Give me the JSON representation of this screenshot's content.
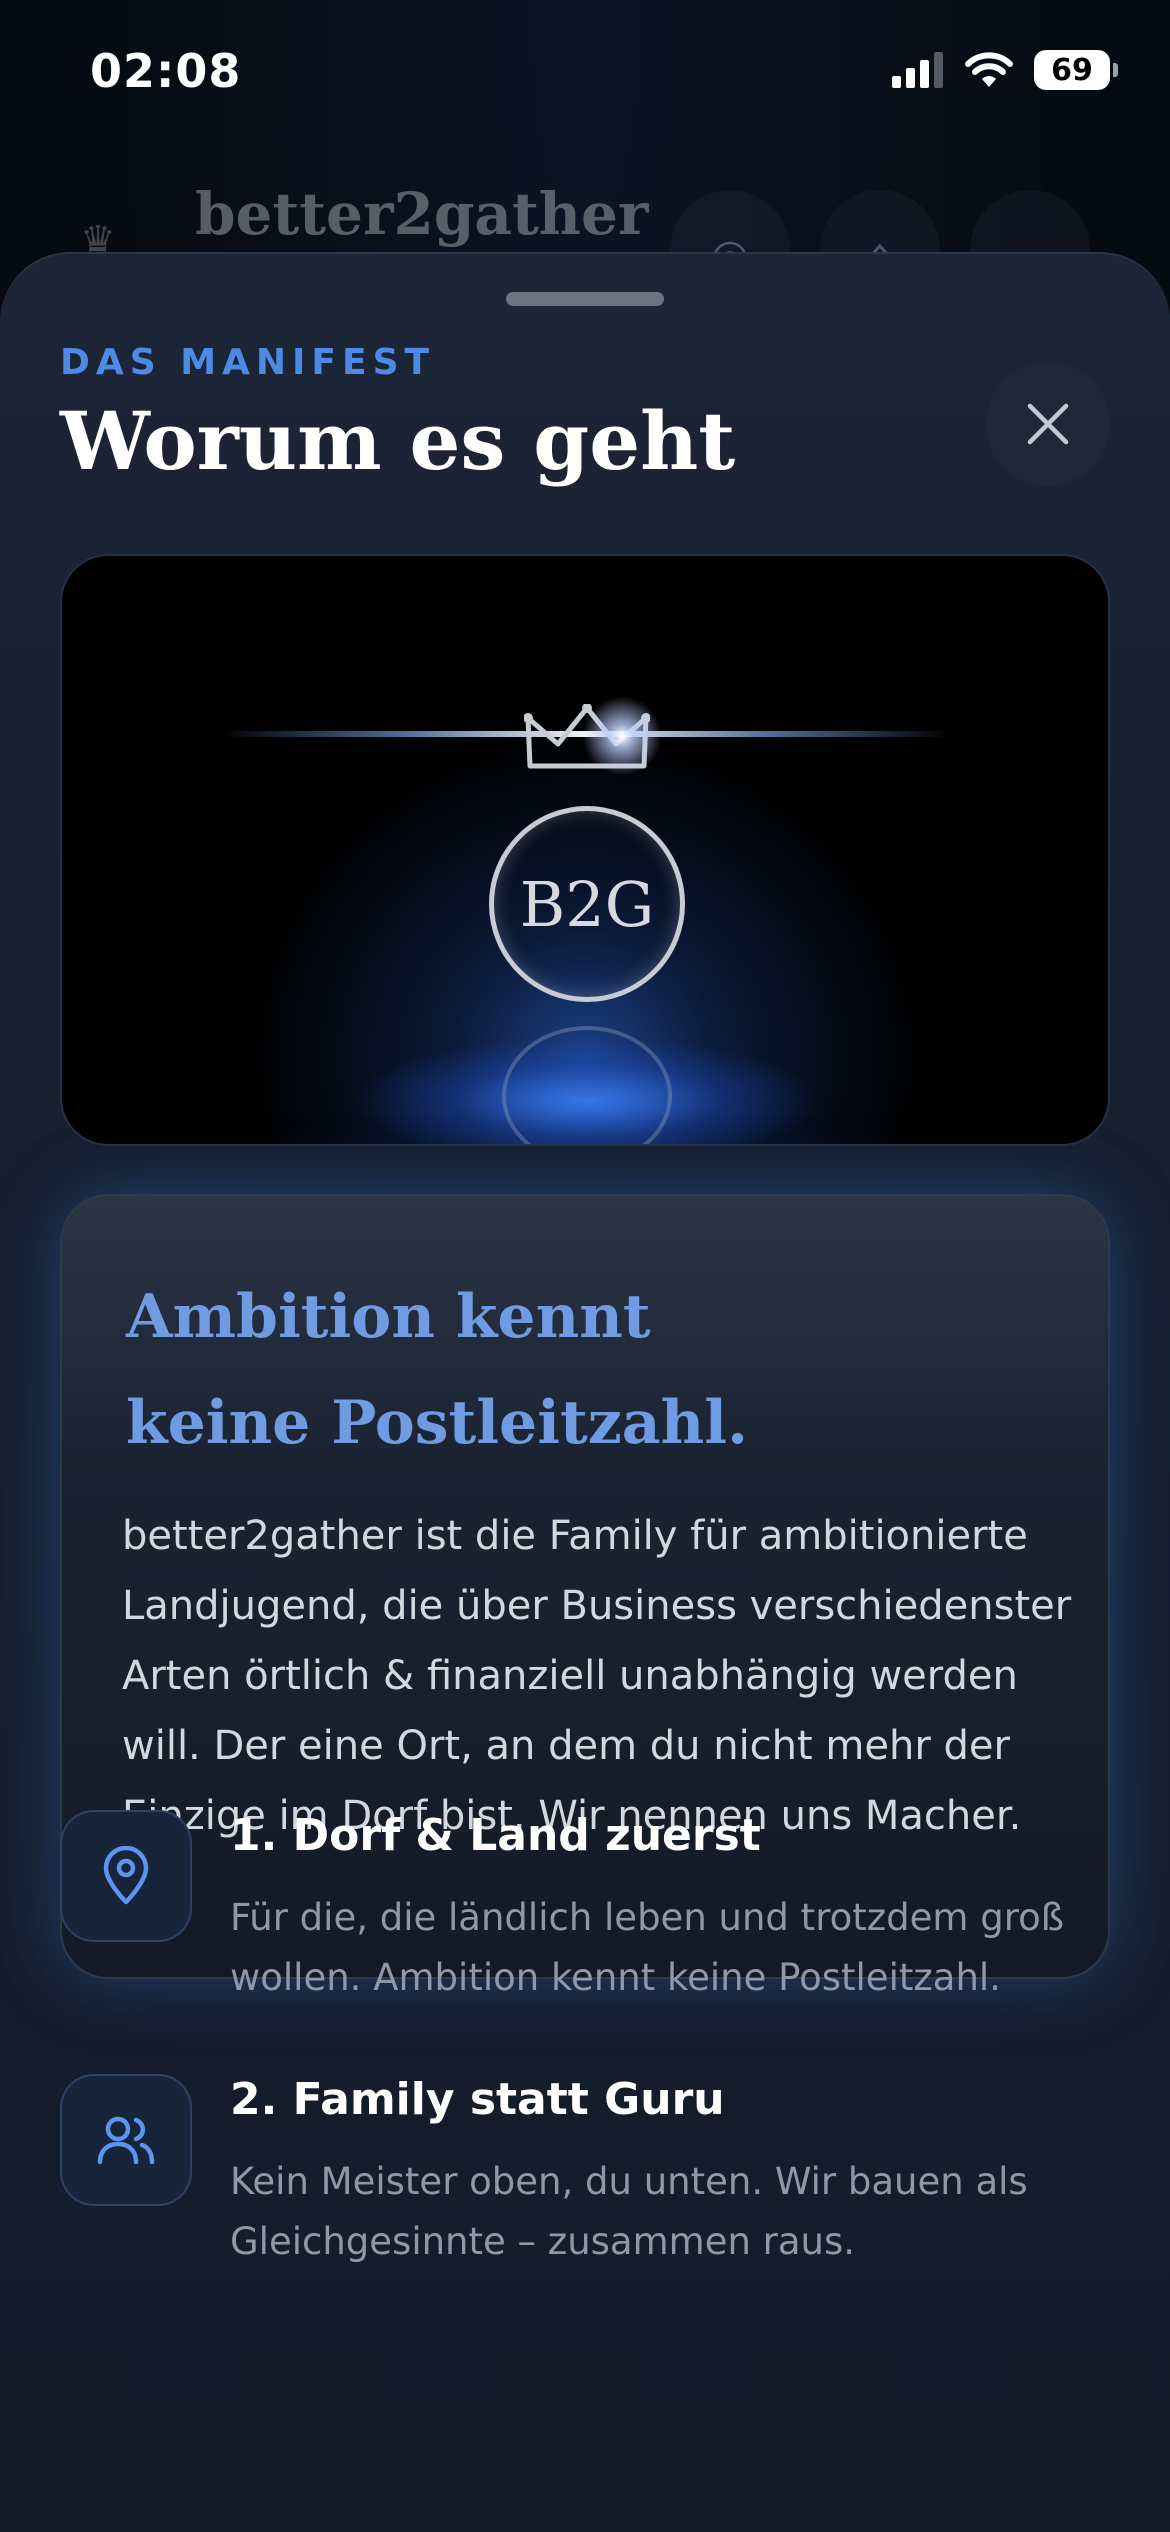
{
  "status_bar": {
    "time": "02:08",
    "battery": "69"
  },
  "background_app": {
    "brand": "better2gather"
  },
  "sheet": {
    "kicker": "DAS MANIFEST",
    "title": "Worum es geht",
    "hero_logo_text": "B2G"
  },
  "manifest_card": {
    "headline_line1": "Ambition kennt",
    "headline_line2": "keine Postleitzahl.",
    "body": "better2gather ist die Family für ambitionierte Landjugend, die über Business verschiedenster Arten örtlich & finanziell unabhängig werden will. Der eine Ort, an dem du nicht mehr der Einzige im Dorf bist. Wir nennen uns Macher."
  },
  "features": [
    {
      "icon": "location-pin-icon",
      "title": "1. Dorf & Land zuerst",
      "description": "Für die, die ländlich leben und trotzdem groß wollen. Ambition kennt keine Postleitzahl."
    },
    {
      "icon": "users-icon",
      "title": "2. Family statt Guru",
      "description": "Kein Meister oben, du unten. Wir bauen als Gleichgesinnte – zusammen raus."
    }
  ],
  "colors": {
    "accent": "#4d8ae6",
    "headline": "#6f9be3",
    "sheet_bg": "#162030",
    "page_bg": "#070b14"
  }
}
